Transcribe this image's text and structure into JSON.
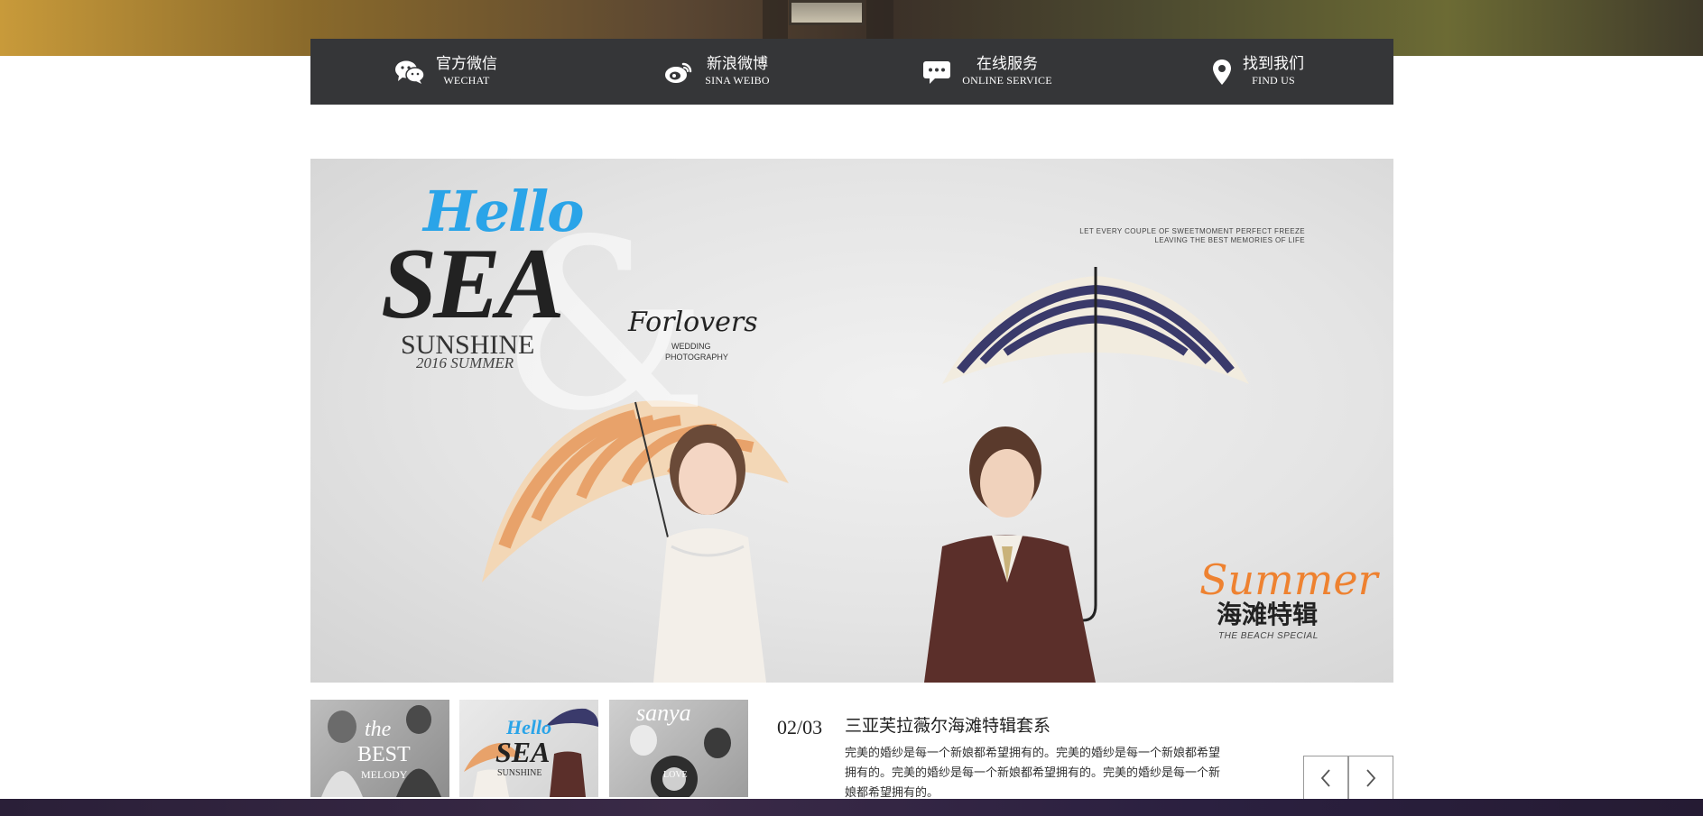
{
  "contact_bar": {
    "items": [
      {
        "icon": "wechat-icon",
        "cn": "官方微信",
        "en": "WECHAT"
      },
      {
        "icon": "weibo-icon",
        "cn": "新浪微博",
        "en": "SINA WEIBO"
      },
      {
        "icon": "chat-bubble-icon",
        "cn": "在线服务",
        "en": "ONLINE SERVICE"
      },
      {
        "icon": "location-pin-icon",
        "cn": "找到我们",
        "en": "FIND US"
      }
    ]
  },
  "hero": {
    "hello": "Hello",
    "sea": "SEA",
    "sunshine": "SUNSHINE",
    "year": "2016 SUMMER",
    "amp": "&",
    "forlovers": "Forlovers",
    "wedding": "WEDDING",
    "photography": "PHOTOGRAPHY",
    "tagline_line1": "LET EVERY COUPLE OF SWEETMOMENT PERFECT FREEZE",
    "tagline_line2": "LEAVING THE BEST MEMORIES OF LIFE",
    "summer_script": "Summer",
    "beach_cn": "海滩特辑",
    "beach_en": "THE BEACH SPECIAL"
  },
  "thumbnails": [
    {
      "label_top": "the",
      "label_main": "BEST",
      "label_sub": "MELODY"
    },
    {
      "label_top": "Hello",
      "label_main": "SEA",
      "label_sub": "SUNSHINE"
    },
    {
      "label_top": "sanya",
      "label_main": "LOVE",
      "label_sub": ""
    }
  ],
  "slider": {
    "counter": "02/03",
    "title": "三亚芙拉薇尔海滩特辑套系",
    "description": "完美的婚纱是每一个新娘都希望拥有的。完美的婚纱是每一个新娘都希望拥有的。完美的婚纱是每一个新娘都希望拥有的。完美的婚纱是每一个新娘都希望拥有的。"
  },
  "colors": {
    "contact_bar_bg": "#353638",
    "hello_blue": "#2aa4e8",
    "summer_orange": "#f0781e"
  }
}
